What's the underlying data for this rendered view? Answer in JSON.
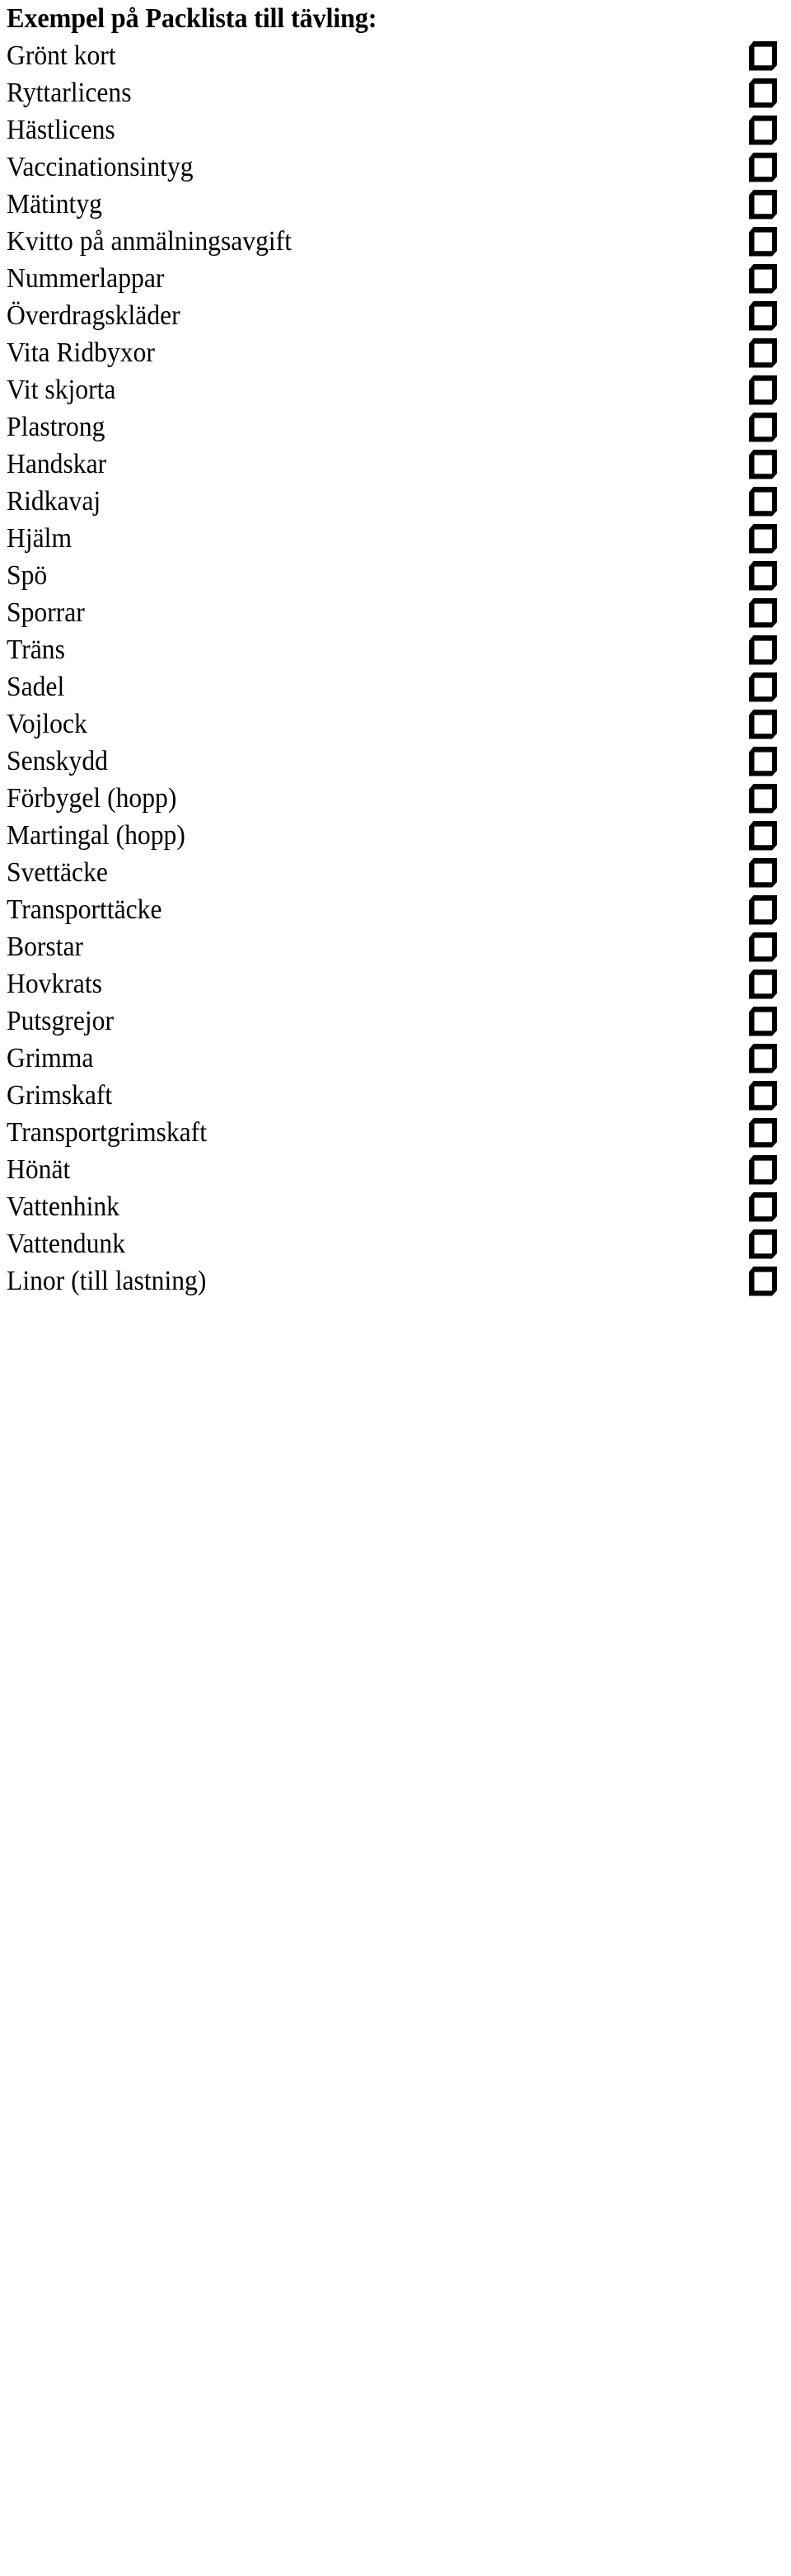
{
  "document": {
    "title": "Exempel på Packlista till tävling:",
    "language": "sv",
    "background_color": "#ffffff",
    "text_color": "#000000"
  },
  "checklist": {
    "checkbox_icon": "empty-checkbox-icon",
    "all_unchecked": true,
    "item_count": 32,
    "items": [
      {
        "label": "Grönt kort",
        "checked": false
      },
      {
        "label": "Ryttarlicens",
        "checked": false
      },
      {
        "label": "Hästlicens",
        "checked": false
      },
      {
        "label": "Vaccinationsintyg",
        "checked": false
      },
      {
        "label": "Mätintyg",
        "checked": false
      },
      {
        "label": "Kvitto på anmälningsavgift",
        "checked": false
      },
      {
        "label": "Nummerlappar",
        "checked": false
      },
      {
        "label": "Överdragskläder",
        "checked": false
      },
      {
        "label": "Vita Ridbyxor",
        "checked": false
      },
      {
        "label": "Vit skjorta",
        "checked": false
      },
      {
        "label": "Plastrong",
        "checked": false
      },
      {
        "label": "Handskar",
        "checked": false
      },
      {
        "label": "Ridkavaj",
        "checked": false
      },
      {
        "label": "Hjälm",
        "checked": false
      },
      {
        "label": "Spö",
        "checked": false
      },
      {
        "label": "Sporrar",
        "checked": false
      },
      {
        "label": "Träns",
        "checked": false
      },
      {
        "label": "Sadel",
        "checked": false
      },
      {
        "label": "Vojlock",
        "checked": false
      },
      {
        "label": "Senskydd",
        "checked": false
      },
      {
        "label": "Förbygel (hopp)",
        "checked": false
      },
      {
        "label": "Martingal (hopp)",
        "checked": false
      },
      {
        "label": "Svettäcke",
        "checked": false
      },
      {
        "label": "Transporttäcke",
        "checked": false
      },
      {
        "label": "Borstar",
        "checked": false
      },
      {
        "label": "Hovkrats",
        "checked": false
      },
      {
        "label": "Putsgrejor",
        "checked": false
      },
      {
        "label": "Grimma",
        "checked": false
      },
      {
        "label": "Grimskaft",
        "checked": false
      },
      {
        "label": "Transportgrimskaft",
        "checked": false
      },
      {
        "label": "Hönät",
        "checked": false
      },
      {
        "label": "Vattenhink",
        "checked": false
      },
      {
        "label": "Vattendunk",
        "checked": false
      },
      {
        "label": "Linor (till lastning)",
        "checked": false
      }
    ]
  }
}
